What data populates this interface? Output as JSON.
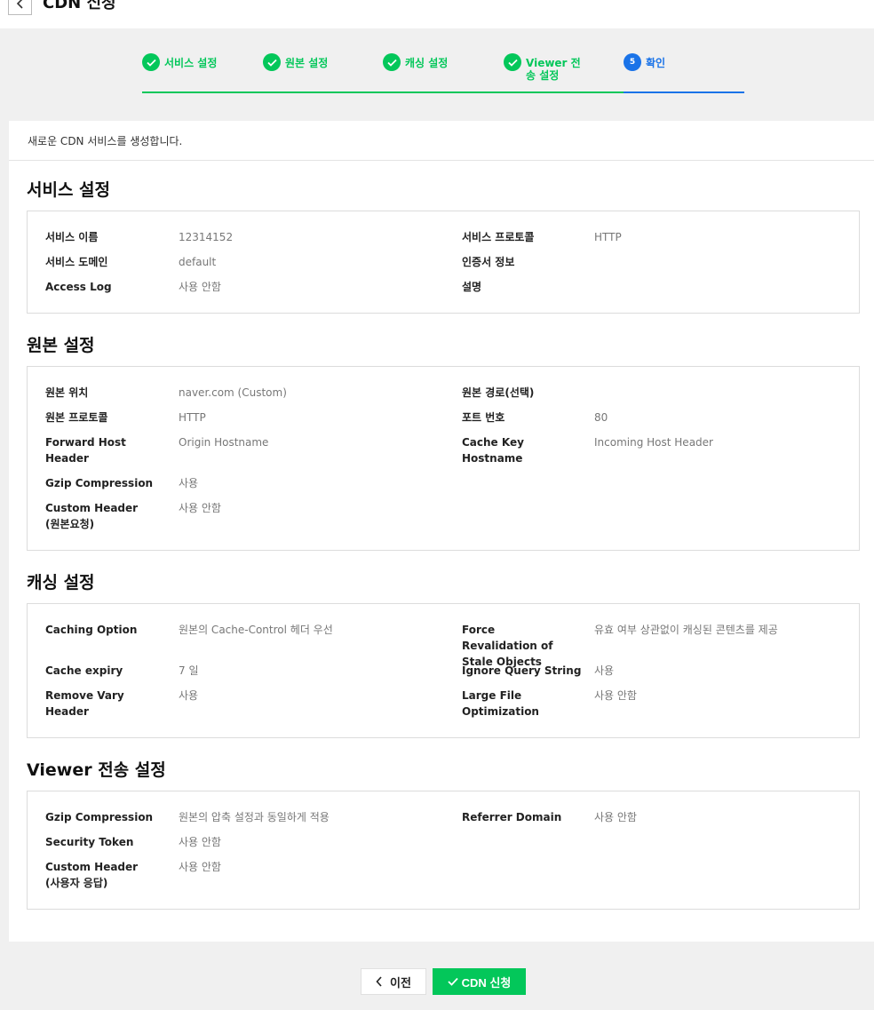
{
  "header": {
    "title": "CDN 신청"
  },
  "stepper": {
    "steps": [
      {
        "label": "서비스 설정",
        "state": "done"
      },
      {
        "label": "원본 설정",
        "state": "done"
      },
      {
        "label": "캐싱 설정",
        "state": "done"
      },
      {
        "label": "Viewer 전송 설정",
        "state": "done"
      },
      {
        "label": "확인",
        "number": "5",
        "state": "active"
      }
    ]
  },
  "intro": "새로운 CDN 서비스를 생성합니다.",
  "service": {
    "title": "서비스 설정",
    "service_name_label": "서비스 이름",
    "service_name": "12314152",
    "service_protocol_label": "서비스 프로토콜",
    "service_protocol": "HTTP",
    "service_domain_label": "서비스 도메인",
    "service_domain": "default",
    "cert_label": "인증서 정보",
    "cert": "",
    "access_log_label": "Access Log",
    "access_log": "사용 안함",
    "desc_label": "설명",
    "desc": ""
  },
  "origin": {
    "title": "원본 설정",
    "location_label": "원본 위치",
    "location": "naver.com (Custom)",
    "path_label": "원본 경로(선택)",
    "path": "",
    "protocol_label": "원본 프로토콜",
    "protocol": "HTTP",
    "port_label": "포트 번호",
    "port": "80",
    "fwd_host_label": "Forward Host Header",
    "fwd_host": "Origin Hostname",
    "cache_key_label": "Cache Key Hostname",
    "cache_key": "Incoming Host Header",
    "gzip_label": "Gzip Compression",
    "gzip": "사용",
    "custom_header_label": "Custom Header (원본요청)",
    "custom_header": "사용 안함"
  },
  "caching": {
    "title": "캐싱 설정",
    "option_label": "Caching Option",
    "option": "원본의 Cache-Control 헤더 우선",
    "force_label": "Force Revalidation of Stale Objects",
    "force": "유효 여부 상관없이 캐싱된 콘텐츠를 제공",
    "expiry_label": "Cache expiry",
    "expiry": "7 일",
    "ignore_qs_label": "Ignore Query String",
    "ignore_qs": "사용",
    "vary_label": "Remove Vary Header",
    "vary": "사용",
    "large_file_label": "Large File Optimization",
    "large_file": "사용 안함"
  },
  "viewer": {
    "title": "Viewer 전송 설정",
    "gzip_label": "Gzip Compression",
    "gzip": "원본의 압축 설정과 동일하게 적용",
    "referrer_label": "Referrer Domain",
    "referrer": "사용 안함",
    "token_label": "Security Token",
    "token": "사용 안함",
    "custom_header_label": "Custom Header (사용자 응답)",
    "custom_header": "사용 안함"
  },
  "footer": {
    "prev_label": "이전",
    "submit_label": "CDN 신청"
  },
  "colors": {
    "accent_green": "#03c75a",
    "accent_blue": "#1a73e8"
  }
}
